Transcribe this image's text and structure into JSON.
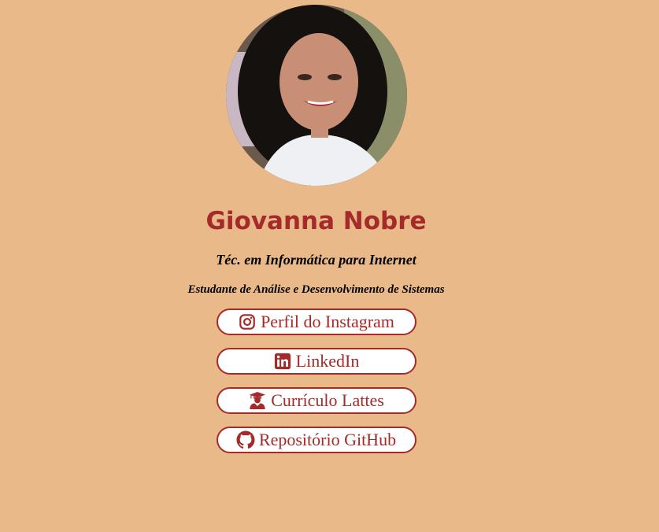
{
  "profile": {
    "name": "Giovanna Nobre",
    "subtitle": "Téc. em Informática para Internet",
    "description": "Estudante de Análise e Desenvolvimento de Sistemas"
  },
  "links": [
    {
      "label": "Perfil do Instagram",
      "icon": "instagram-icon"
    },
    {
      "label": "LinkedIn",
      "icon": "linkedin-icon"
    },
    {
      "label": "Currículo Lattes",
      "icon": "graduate-icon"
    },
    {
      "label": "Repositório GitHub",
      "icon": "github-icon"
    }
  ],
  "colors": {
    "background": "#e9b98a",
    "accent": "#a52a2a",
    "button_bg": "#ffffff"
  }
}
